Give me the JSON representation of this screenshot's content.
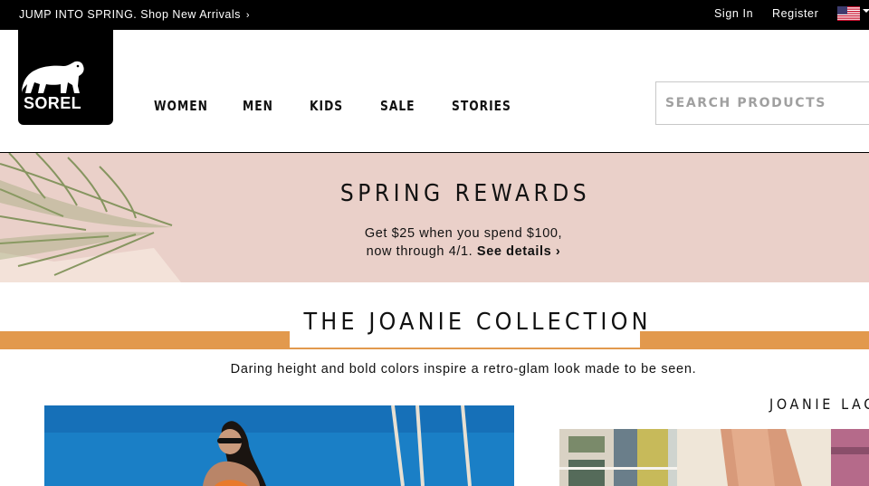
{
  "topbar": {
    "promo_text": "JUMP INTO SPRING. Shop New Arrivals",
    "promo_chevron": "›",
    "sign_in": "Sign In",
    "register": "Register",
    "flag_icon": "us-flag-icon"
  },
  "header": {
    "logo_text": "SOREL",
    "nav": [
      "WOMEN",
      "MEN",
      "KIDS",
      "SALE",
      "STORIES"
    ],
    "search_placeholder": "SEARCH PRODUCTS"
  },
  "rewards": {
    "title": "SPRING REWARDS",
    "line1": "Get $25 when you spend $100,",
    "line2": "now through 4/1.",
    "link": "See details ›",
    "background": "#ead0c9"
  },
  "collection": {
    "title": "THE JOANIE COLLECTION",
    "description": "Daring height and bold colors inspire a retro-glam look made to be seen.",
    "side_title": "JOANIE LAC",
    "accent": "#e2994d"
  }
}
